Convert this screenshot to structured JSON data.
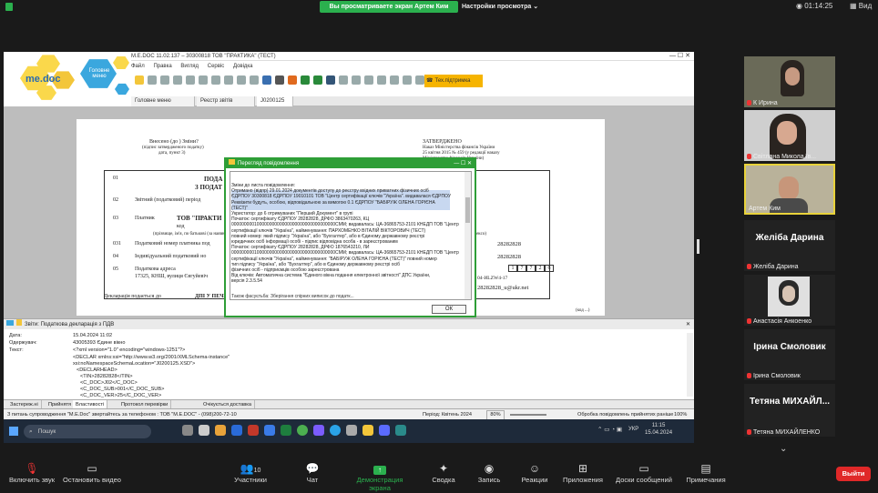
{
  "zoom_top": {
    "share_banner": "Вы просматриваете экран Артем Ким",
    "view_options": "Настройки просмотра",
    "timer": "01:14:25",
    "view": "Вид"
  },
  "app": {
    "title": "M.E.DOC 11.02.137 – 30300818 ТОВ \"ПРАКТИКА\" (ТЕСТ)",
    "logo": "me.doc",
    "logo_hex": "Головне меню",
    "menu": [
      "Файл",
      "Правка",
      "Вигляд",
      "Сервіс",
      "Довідка"
    ],
    "tech_support": "Тех.підтримка",
    "tabs": [
      "Головне меню",
      "Реєстр звітів",
      "J0200125 Х"
    ]
  },
  "doc": {
    "left_hdr_1": "Внесено (до ) Зміни?",
    "left_hdr_2": "(підпис затвердженого податку)",
    "left_hdr_3": "дата, пункт 3)",
    "right_hdr_1": "ЗАТВЕРДЖЕНО",
    "right_hdr_2": "Наказ Міністерства фінансів України",
    "right_hdr_3": "25 квітня 2015 № 459 (у редакції наказу",
    "right_hdr_4": "Міністерства фінансів України)",
    "right_hdr_5": "14.12.2023 № 653",
    "row_01": "01",
    "row_01_a": "ПОДА",
    "row_01_b": "З ПОДАТ",
    "row_02": "02",
    "row_02_text": "Звітний (податковий) період",
    "row_03": "03",
    "row_03_text": "Платник",
    "row_03_name": "ТОВ \"ПРАКТИ",
    "row_03_sub": "код",
    "row_03_note": "(прізвище, ім'я, по батькові (за наявності) / найменування ...",
    "row_031": "031",
    "row_031_text": "Податковий номер платника под",
    "row_04": "04",
    "row_04_text": "Індивідуальний податковий но",
    "row_05": "05",
    "row_05_text": "Податкова адреса",
    "row_05_addr": "17325, КНШ, вулиця Євгуйевіч",
    "footer": "Декларація подається до",
    "footer_2": "ДПІ У ПЕЧЕ",
    "code_1": "28282828",
    "code_2": "28282828",
    "num_cells": [
      "1",
      "7",
      "7",
      "2",
      "6"
    ],
    "code_3": "04-ИLZW4-17",
    "email": "28282828_u@ukr.net",
    "note": "(код ...)",
    "sector_code": "сектор (тексо)"
  },
  "dialog": {
    "title": "Перегляд повідомлення",
    "ok": "ОК",
    "lines": [
      "Зміни до листа повідомлення:",
      "Отримано (відпр) 29.01.2024 документів доступу до реєстру вхідних приватних фізичних осіб",
      "ЄДРПОУ 30300818 ЄДРПОУ 19010101 ТОВ \"Центр сертифікації ключів \"Україна\". видавалася ЄДРПОУ",
      "Реквізити будуть, особою, відповідальною за вимогою 0.1 ЄДРПОУ \"БАБІРУЖ ОЛЕНА ГОРІЄНА",
      "(ТЕСТ)\"",
      "Укристатор: до 6 отримуваних \"Перший Документ\" в групі",
      "Початок: сертифікату ЄДРПОУ 28282828, ДРФО 3863470263, КЦ",
      "00000000010000000000000000000000000000000CMM; видавалась: ЦА-36865753-2101 КНЕДП ТОВ \"Центр",
      "сертифікації ключів \"Україна\", найменування: ПАРХОМЕНКО ВІТАЛІЙ ВІКТОРОВИЧ (ТЕСТ)",
      "повний номер: який підпису \"Україна\", або \"Бухгалтер\", або в Єдиному державному реєстрі",
      "юридичних осіб інформації особі - підпис відповідна особа - в зареєстрованим",
      "Початок: сертифікату ЄДРПОУ 28282828, ДРФО 1876543210, ЛИ",
      "00000000010000000000000000000000000000000CMM; видавалась: ЦА-36865753-2101 КНЕДП ТОВ \"Центр",
      "сертифікації ключів \"Україна\", найменування: \"БАБІРУЖ ОЛЕНА ГОРІЄНА (ТЕСТ)\" повний номер",
      "тип підпису \"Україна\", або \"Бухгалтер\", або в Єдиному державному реєстрі осіб",
      "фізичних осіб - підприємців особою зареєстрована",
      "Від ключів: Автоматична система \"Єдиного вікна подання електронної звітності\" ДПС України,",
      "версія 2.3.5.54"
    ],
    "overflow_line": "Також фасуєтьба: Зберігання спірних виписок до податк..."
  },
  "panel": {
    "header": "Звіти: Податкова декларація з ПДВ",
    "rows": [
      {
        "k": "Дата:",
        "v": "15.04.2024 11:02"
      },
      {
        "k": "Одержувач:",
        "v": "43005393 Єдине вікно"
      },
      {
        "k": "Текст:",
        "v": "<?xml version=\"1.0\" encoding=\"windows-1251\"?>"
      }
    ],
    "xml": [
      "<DECLAR xmlns:xsi=\"http://www.w3.org/2001/XMLSchema-instance\"",
      "xsi:noNamespaceSchemaLocation=\"J0200125.XSD\">",
      "<DECLARHEAD>",
      "<TIN>28282828</TIN>",
      "<C_DOC>J02</C_DOC>",
      "<C_DOC_SUB>001</C_DOC_SUB>",
      "<C_DOC_VER>25</C_DOC_VER>"
    ],
    "bottom_tabs": [
      "Застереж.ні",
      "Прийнятя",
      "Властивості",
      "Протокол перевірки",
      "Очікується доставка"
    ]
  },
  "status": {
    "left": "З питань супроводження \"M.E.Doc\" звертайтесь за телефоном : ТОВ \"М.Е.DOC\" - (098)200-72-10",
    "period": "Період: Квітень 2024",
    "zoom": "80%",
    "processing": "Обробка повідомлень прийнятих раніше",
    "percent": "100%"
  },
  "taskbar": {
    "search": "Пошук",
    "lang": "УКР",
    "time": "11:15",
    "date": "15.04.2024"
  },
  "participants": [
    {
      "name": "К Ирина",
      "type": "video",
      "muted": true
    },
    {
      "name": "Світлана Микола їв...",
      "type": "video",
      "muted": true
    },
    {
      "name": "Артем Ким",
      "type": "video",
      "muted": false,
      "active": true
    },
    {
      "name": "Желіба Дарина",
      "type": "name",
      "muted": true
    },
    {
      "name": "Анастасія Анкоенко",
      "type": "video",
      "muted": true
    },
    {
      "name": "Ірина Смоловик",
      "type": "name",
      "muted": true
    },
    {
      "name": "Тетяна МИХАЙЛ...",
      "type": "name",
      "muted": true,
      "sub": "Тетяна МИХАЙЛЕНКО"
    }
  ],
  "bottom": {
    "mic": "Включить звук",
    "video": "Остановить видео",
    "participants": "Участники",
    "participants_count": "10",
    "chat": "Чат",
    "share": "Демонстрация экрана",
    "summary": "Сводка",
    "record": "Запись",
    "reactions": "Реакции",
    "apps": "Приложения",
    "whiteboards": "Доски сообщений",
    "notes": "Примечания",
    "leave": "Выйти"
  },
  "colors": {
    "zoom_green": "#2bb04e",
    "medoc_yellow": "#fad84b",
    "medoc_blue": "#3aa7de",
    "leave_red": "#e02828",
    "active_border": "#e8d23a"
  }
}
